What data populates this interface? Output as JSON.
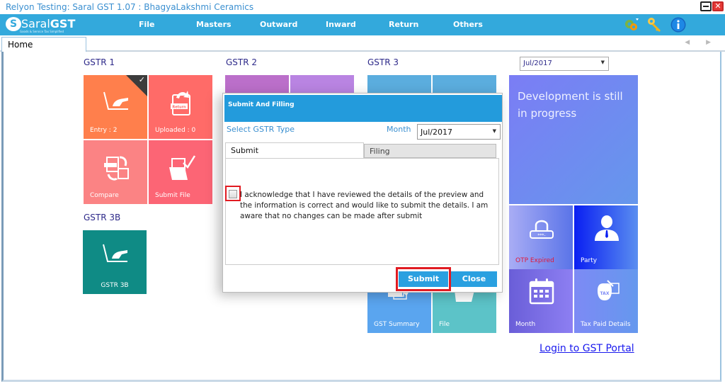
{
  "window": {
    "title": "Relyon Testing: Saral GST  1.07 : BhagyaLakshmi Ceramics",
    "minimize_icon": "minimize-icon",
    "close_icon": "close-icon",
    "close_glyph": "✕"
  },
  "logo": {
    "mark": "S",
    "name_light": "Saral",
    "name_bold": "GST",
    "tagline": "Goods & Service Tax Simplified"
  },
  "menu": {
    "items": [
      {
        "label": "File"
      },
      {
        "label": "Masters"
      },
      {
        "label": "Outward"
      },
      {
        "label": "Inward"
      },
      {
        "label": "Return"
      },
      {
        "label": "Others"
      }
    ],
    "tools": [
      "settings-icon",
      "key-icon",
      "info-icon"
    ]
  },
  "tabs": {
    "home": "Home",
    "arrows": "◀ ▶"
  },
  "sections": {
    "gstr1": {
      "title": "GSTR 1",
      "tiles": [
        {
          "label": "Entry : 2",
          "icon": "laptop-hand-icon",
          "color": "#ff7f4c",
          "checked": true
        },
        {
          "label": "Uploaded : 0",
          "icon": "return-upload-icon",
          "color": "#ff6b68"
        },
        {
          "label": "Compare",
          "icon": "compare-icon",
          "color": "#fb8384"
        },
        {
          "label": "Submit File",
          "icon": "submit-file-icon",
          "color": "#fc6575"
        }
      ]
    },
    "gstr2": {
      "title": "GSTR 2",
      "colors": [
        "#bb6fca",
        "#b984e2"
      ]
    },
    "gstr3": {
      "title": "GSTR 3",
      "colors": [
        "#5badde",
        "#5badde"
      ],
      "tiles": [
        {
          "label": "GST Summary",
          "icon": "gst-summary-icon",
          "color": "#5aa5ef"
        },
        {
          "label": "File",
          "icon": "folder-icon",
          "color": "#5cc3c8"
        }
      ]
    },
    "gstr3b": {
      "title": "GSTR 3B",
      "tiles": [
        {
          "label": "GSTR 3B",
          "icon": "laptop-hand-icon",
          "color": "#0f8b85"
        }
      ]
    }
  },
  "right_panel": {
    "month_select": "Jul/2017",
    "dev_message": "Development is still in progress",
    "tiles": [
      {
        "label": "OTP Expired",
        "icon": "lock-icon",
        "label_color": "#e0193a"
      },
      {
        "label": "Party",
        "icon": "user-icon",
        "label_color": "#ffffff"
      },
      {
        "label": "Month",
        "icon": "calendar-icon",
        "label_color": "#ffffff"
      },
      {
        "label": "Tax Paid Details",
        "icon": "tax-bag-icon",
        "label_color": "#ffffff"
      }
    ],
    "portal_link": "Login to GST Portal"
  },
  "dialog": {
    "title": "Submit And Filling",
    "gstr_type_label": "Select GSTR Type",
    "month_label": "Month",
    "month_value": "Jul/2017",
    "tabs": [
      {
        "label": "Submit",
        "active": true
      },
      {
        "label": "Filing",
        "active": false
      }
    ],
    "acknowledge_checked": false,
    "acknowledge_text": "I acknowledge that I have reviewed the details of the preview and the information is correct and would like to submit the details. I am aware that no changes can be made after submit",
    "submit_label": "Submit",
    "close_label": "Close"
  },
  "colors": {
    "accent": "#33a9dc",
    "dialog_header": "#239bdc",
    "highlight": "#e11b22",
    "section_title": "#2e2a8a"
  }
}
